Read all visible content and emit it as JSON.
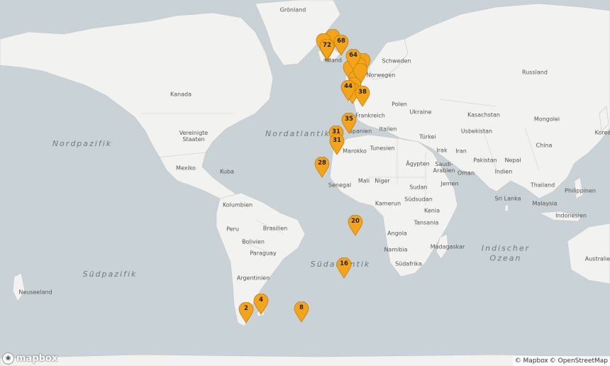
{
  "countries": [
    {
      "name": "Grönland",
      "id": "groenland"
    },
    {
      "name": "Kanada",
      "id": "kanada"
    },
    {
      "name": "Vereinigte\nStaaten",
      "id": "usa"
    },
    {
      "name": "Mexiko",
      "id": "mexiko"
    },
    {
      "name": "Kuba",
      "id": "kuba"
    },
    {
      "name": "Kolumbien",
      "id": "kolumbien"
    },
    {
      "name": "Peru",
      "id": "peru"
    },
    {
      "name": "Brasilien",
      "id": "brasilien"
    },
    {
      "name": "Bolivien",
      "id": "bolivien"
    },
    {
      "name": "Paraguay",
      "id": "paraguay"
    },
    {
      "name": "Argentinien",
      "id": "argentinien"
    },
    {
      "name": "Neuseeland",
      "id": "neuseeland"
    },
    {
      "name": "Island",
      "id": "island"
    },
    {
      "name": "Schweden",
      "id": "schweden"
    },
    {
      "name": "Norwegen",
      "id": "norwegen"
    },
    {
      "name": "Russland",
      "id": "russland"
    },
    {
      "name": "Polen",
      "id": "polen"
    },
    {
      "name": "Ukraine",
      "id": "ukraine"
    },
    {
      "name": "Kasachstan",
      "id": "kasachstan"
    },
    {
      "name": "Mongolei",
      "id": "mongolei"
    },
    {
      "name": "Frankreich",
      "id": "frankreich"
    },
    {
      "name": "Italien",
      "id": "italien"
    },
    {
      "name": "Spanien",
      "id": "spanien"
    },
    {
      "name": "Türkei",
      "id": "tuerkei"
    },
    {
      "name": "Usbekistan",
      "id": "usbekistan"
    },
    {
      "name": "China",
      "id": "china"
    },
    {
      "name": "Irak",
      "id": "irak"
    },
    {
      "name": "Iran",
      "id": "iran"
    },
    {
      "name": "Marokko",
      "id": "marokko"
    },
    {
      "name": "Tunesien",
      "id": "tunesien"
    },
    {
      "name": "Ägypten",
      "id": "aegypten"
    },
    {
      "name": "Saudi-\nArabien",
      "id": "saudi"
    },
    {
      "name": "Oman",
      "id": "oman"
    },
    {
      "name": "Pakistan",
      "id": "pakistan"
    },
    {
      "name": "Nepal",
      "id": "nepal"
    },
    {
      "name": "Indien",
      "id": "indien"
    },
    {
      "name": "Jemen",
      "id": "jemen"
    },
    {
      "name": "Senegal",
      "id": "senegal"
    },
    {
      "name": "Mali",
      "id": "mali"
    },
    {
      "name": "Niger",
      "id": "niger"
    },
    {
      "name": "Sudan",
      "id": "sudan"
    },
    {
      "name": "Kamerun",
      "id": "kamerun"
    },
    {
      "name": "Südsudan",
      "id": "suedsudan"
    },
    {
      "name": "Kenia",
      "id": "kenia"
    },
    {
      "name": "Tansania",
      "id": "tansania"
    },
    {
      "name": "Angola",
      "id": "angola"
    },
    {
      "name": "Namibia",
      "id": "namibia"
    },
    {
      "name": "Südafrika",
      "id": "suedafrika"
    },
    {
      "name": "Madagaskar",
      "id": "madagaskar"
    },
    {
      "name": "Thailand",
      "id": "thailand"
    },
    {
      "name": "Sri Lanka",
      "id": "srilanka"
    },
    {
      "name": "Malaysia",
      "id": "malaysia"
    },
    {
      "name": "Philippinen",
      "id": "philippinen"
    },
    {
      "name": "Indonesien",
      "id": "indonesien"
    },
    {
      "name": "Australien",
      "id": "australien"
    },
    {
      "name": "Korea",
      "id": "korea"
    }
  ],
  "oceans": [
    {
      "name": "Nordpazifik",
      "id": "nordpazifik"
    },
    {
      "name": "Nordatlantik",
      "id": "nordatlantik"
    },
    {
      "name": "Südpazifik",
      "id": "suedpazifik"
    },
    {
      "name": "Südatlantik",
      "id": "suedatlantik"
    },
    {
      "name": "Indischer\nOzean",
      "id": "indischer"
    }
  ],
  "markers": [
    {
      "label": "72",
      "id": "m72"
    },
    {
      "label": "68",
      "id": "m68"
    },
    {
      "label": "64",
      "id": "m64"
    },
    {
      "label": "44",
      "id": "m44"
    },
    {
      "label": "38",
      "id": "m38"
    },
    {
      "label": "35",
      "id": "m35"
    },
    {
      "label": "31",
      "id": "m31a"
    },
    {
      "label": "31",
      "id": "m31b"
    },
    {
      "label": "28",
      "id": "m28"
    },
    {
      "label": "20",
      "id": "m20"
    },
    {
      "label": "16",
      "id": "m16"
    },
    {
      "label": "8",
      "id": "m8"
    },
    {
      "label": "4",
      "id": "m4"
    },
    {
      "label": "2",
      "id": "m2"
    },
    {
      "label": "",
      "id": "mc1"
    },
    {
      "label": "",
      "id": "mc2"
    },
    {
      "label": "",
      "id": "mc3"
    },
    {
      "label": "",
      "id": "mc4"
    },
    {
      "label": "",
      "id": "mc5"
    },
    {
      "label": "",
      "id": "mc6"
    },
    {
      "label": "",
      "id": "mc7"
    },
    {
      "label": "",
      "id": "mc8"
    },
    {
      "label": "",
      "id": "mc9"
    },
    {
      "label": "",
      "id": "mc10"
    }
  ],
  "marker_color": "#f4a418",
  "land_color": "#f2f2f0",
  "water_color": "#c9d2d7",
  "logo": {
    "text": "mapbox"
  },
  "attribution": {
    "mapbox": "© Mapbox",
    "osm": "© OpenStreetMap"
  }
}
